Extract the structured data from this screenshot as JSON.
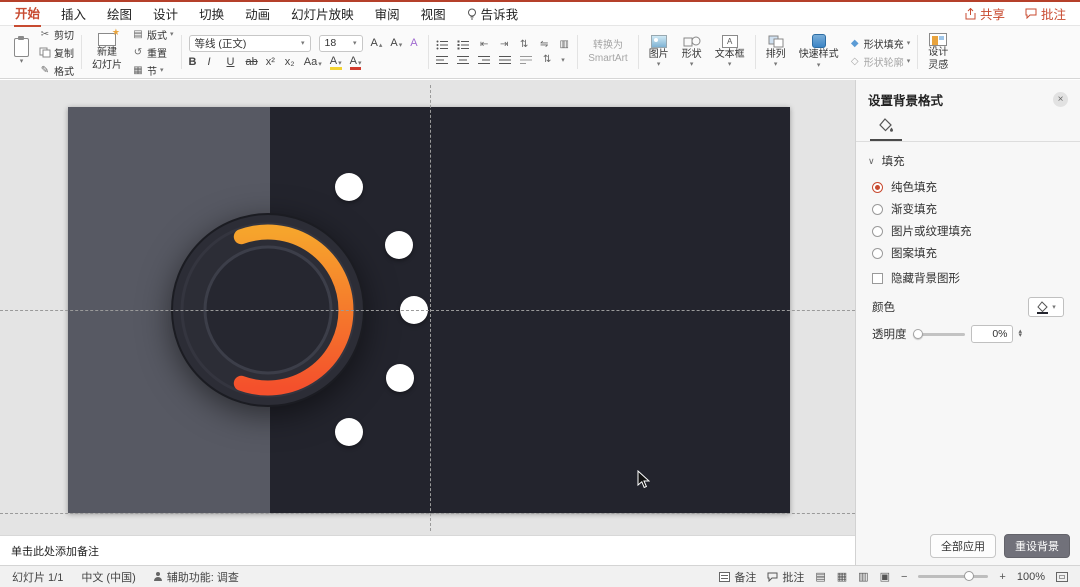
{
  "colors": {
    "accent": "#c84b31",
    "menubar_red": "#b5402a",
    "slide_dark": "#23242d",
    "slide_gray": "#575963",
    "arc_top": "#f6a42c",
    "arc_bottom": "#f4502c",
    "dot_white": "#ffffff"
  },
  "menubar": {
    "items": [
      "开始",
      "插入",
      "绘图",
      "设计",
      "切换",
      "动画",
      "幻灯片放映",
      "审阅",
      "视图"
    ],
    "tell_me": "告诉我",
    "share": "共享",
    "comments": "批注"
  },
  "ribbon": {
    "cut": "剪切",
    "copy": "复制",
    "format_painter": "格式",
    "new_slide_line1": "新建",
    "new_slide_line2": "幻灯片",
    "layout": "版式",
    "reset": "重置",
    "section": "节",
    "font_name": "等线 (正文)",
    "font_size": "18",
    "letters": {
      "bold": "B",
      "italic": "I",
      "underline": "U",
      "strike": "ab",
      "sup": "x²",
      "sub": "x₂",
      "case": "Aa",
      "highlight": "A",
      "font_color": "A",
      "inc": "A",
      "dec": "A",
      "clear": "A"
    },
    "smartart_line1": "转换为",
    "smartart_line2": "SmartArt",
    "picture": "图片",
    "shapes": "形状",
    "textbox": "文本框",
    "arrange": "排列",
    "quick_styles": "快速样式",
    "shape_fill": "形状填充",
    "shape_outline": "形状轮廓",
    "design_line1": "设计",
    "design_line2": "灵感"
  },
  "icons": {
    "caret": "▾",
    "caret_up": "▴",
    "chevron": "∨",
    "cut": "✂",
    "format_painter": "✎",
    "layout": "▤",
    "reset": "↺",
    "section": "▦",
    "star": "★",
    "textbox_letter": "A",
    "diamond_fill": "◆",
    "diamond_outline": "◇",
    "updown": "⇅",
    "columns": "▥",
    "indent_dec": "⇤",
    "indent_inc": "⇥",
    "direction": "⇋",
    "minus": "−",
    "plus": "+",
    "close": "×",
    "view_normal": "▤",
    "view_sorter": "▦",
    "view_reading": "▥",
    "view_show": "▣"
  },
  "panel": {
    "title": "设置背景格式",
    "fill_header": "填充",
    "opt_solid": "纯色填充",
    "opt_gradient": "渐变填充",
    "opt_picture": "图片或纹理填充",
    "opt_pattern": "图案填充",
    "hide_bg": "隐藏背景图形",
    "color_label": "颜色",
    "transparency_label": "透明度",
    "transparency_value": "0%",
    "apply_all": "全部应用",
    "reset_bg": "重设背景"
  },
  "notes": {
    "placeholder": "单击此处添加备注"
  },
  "statusbar": {
    "slide_info": "幻灯片 1/1",
    "language": "中文 (中国)",
    "accessibility": "辅助功能: 调查",
    "notes_label": "备注",
    "comments_label": "批注",
    "zoom_level": "100%"
  }
}
